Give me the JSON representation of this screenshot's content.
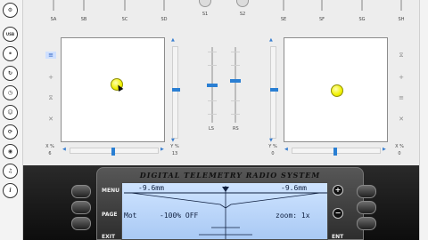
{
  "toolbar": {
    "icons": [
      {
        "name": "settings-wheel-icon",
        "glyph": "⚙"
      },
      {
        "name": "usb-icon",
        "glyph": "USB"
      },
      {
        "name": "mixer-icon",
        "glyph": "⚭"
      },
      {
        "name": "servo-icon",
        "glyph": "↻"
      },
      {
        "name": "timer-icon",
        "glyph": "◷"
      },
      {
        "name": "model-icon",
        "glyph": "☺"
      },
      {
        "name": "refresh-icon",
        "glyph": "⟳"
      },
      {
        "name": "camera-icon",
        "glyph": "◉"
      },
      {
        "name": "sound-icon",
        "glyph": "♫"
      },
      {
        "name": "info-icon",
        "glyph": "i"
      }
    ]
  },
  "switches": [
    "SA",
    "SB",
    "SC",
    "SD",
    "SE",
    "SF",
    "SG",
    "SH"
  ],
  "pots": [
    "S1",
    "S2"
  ],
  "sliders": {
    "left_label": "LS",
    "right_label": "RS",
    "left_level_pct": 50,
    "right_level_pct": 45
  },
  "left_stick": {
    "x_label": "X %",
    "x_value": "6",
    "y_label": "Y %",
    "y_value": "13",
    "x_pct": 6,
    "y_pct": 13
  },
  "right_stick": {
    "y_label": "Y %",
    "y_value": "0",
    "x_label": "X %",
    "x_value": "0",
    "x_pct": 0,
    "y_pct": 0
  },
  "arrows": {
    "up": "▲",
    "down": "▼",
    "left": "◀",
    "right": "▶"
  },
  "side_icons": {
    "mode": "≡",
    "center": "+",
    "lock": "⧖",
    "cross": "✕"
  },
  "radio": {
    "title": "DIGITAL TELEMETRY RADIO SYSTEM",
    "menu": "MENU",
    "page": "PAGE",
    "exit": "EXIT",
    "ent": "ENT",
    "plus": "+",
    "minus": "−",
    "trim_left": "-9.6mm",
    "trim_right": "-9.6mm",
    "line_mot": "Mot",
    "line_pct": "-100% OFF",
    "line_zoom": "zoom: 1x"
  },
  "colors": {
    "accent": "#2a7fd3",
    "ball": "#f1f100",
    "lcd": "#b8d4f8"
  }
}
